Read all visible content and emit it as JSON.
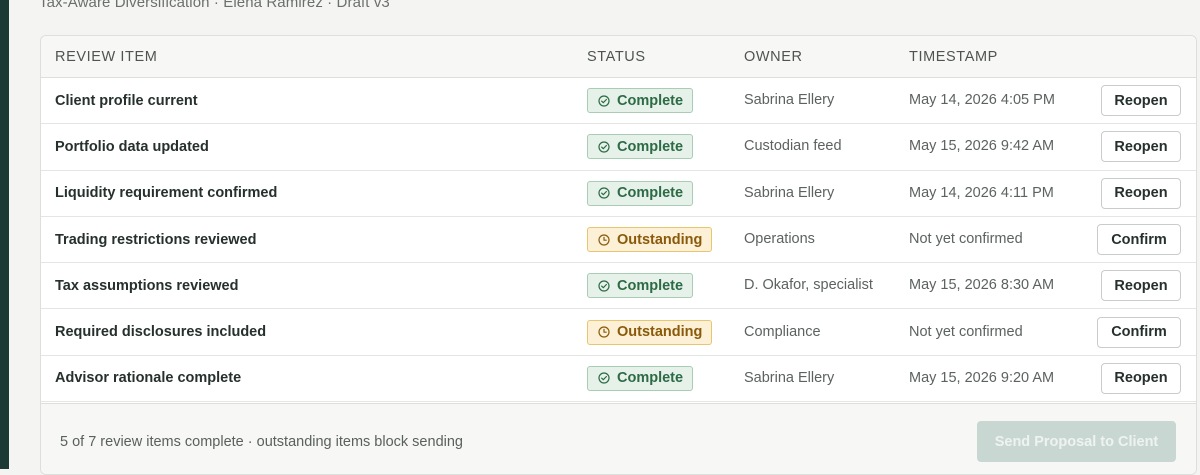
{
  "header": {
    "subtitle": "Tax-Aware Diversification · Elena Ramirez · Draft v3"
  },
  "table": {
    "columns": {
      "item": "REVIEW ITEM",
      "status": "STATUS",
      "owner": "OWNER",
      "timestamp": "TIMESTAMP"
    },
    "rows": [
      {
        "item": "Client profile current",
        "status": "Complete",
        "status_type": "complete",
        "owner": "Sabrina Ellery",
        "timestamp": "May 14, 2026 4:05 PM",
        "action": "Reopen"
      },
      {
        "item": "Portfolio data updated",
        "status": "Complete",
        "status_type": "complete",
        "owner": "Custodian feed",
        "timestamp": "May 15, 2026 9:42 AM",
        "action": "Reopen"
      },
      {
        "item": "Liquidity requirement confirmed",
        "status": "Complete",
        "status_type": "complete",
        "owner": "Sabrina Ellery",
        "timestamp": "May 14, 2026 4:11 PM",
        "action": "Reopen"
      },
      {
        "item": "Trading restrictions reviewed",
        "status": "Outstanding",
        "status_type": "outstanding",
        "owner": "Operations",
        "timestamp": "Not yet confirmed",
        "action": "Confirm"
      },
      {
        "item": "Tax assumptions reviewed",
        "status": "Complete",
        "status_type": "complete",
        "owner": "D. Okafor, specialist",
        "timestamp": "May 15, 2026 8:30 AM",
        "action": "Reopen"
      },
      {
        "item": "Required disclosures included",
        "status": "Outstanding",
        "status_type": "outstanding",
        "owner": "Compliance",
        "timestamp": "Not yet confirmed",
        "action": "Confirm"
      },
      {
        "item": "Advisor rationale complete",
        "status": "Complete",
        "status_type": "complete",
        "owner": "Sabrina Ellery",
        "timestamp": "May 15, 2026 9:20 AM",
        "action": "Reopen"
      }
    ]
  },
  "footer": {
    "summary": "5 of 7 review items complete · outstanding items block sending",
    "send_label": "Send Proposal to Client"
  },
  "icons": {
    "complete": "check-circle-icon",
    "outstanding": "clock-icon"
  },
  "colors": {
    "complete_fg": "#2c6b44",
    "complete_bg": "#e6f1ea",
    "outstanding_fg": "#8a5a0a",
    "outstanding_bg": "#fcf1d6",
    "send_disabled_bg": "#c9d7d2",
    "rail": "#1b3a33"
  }
}
